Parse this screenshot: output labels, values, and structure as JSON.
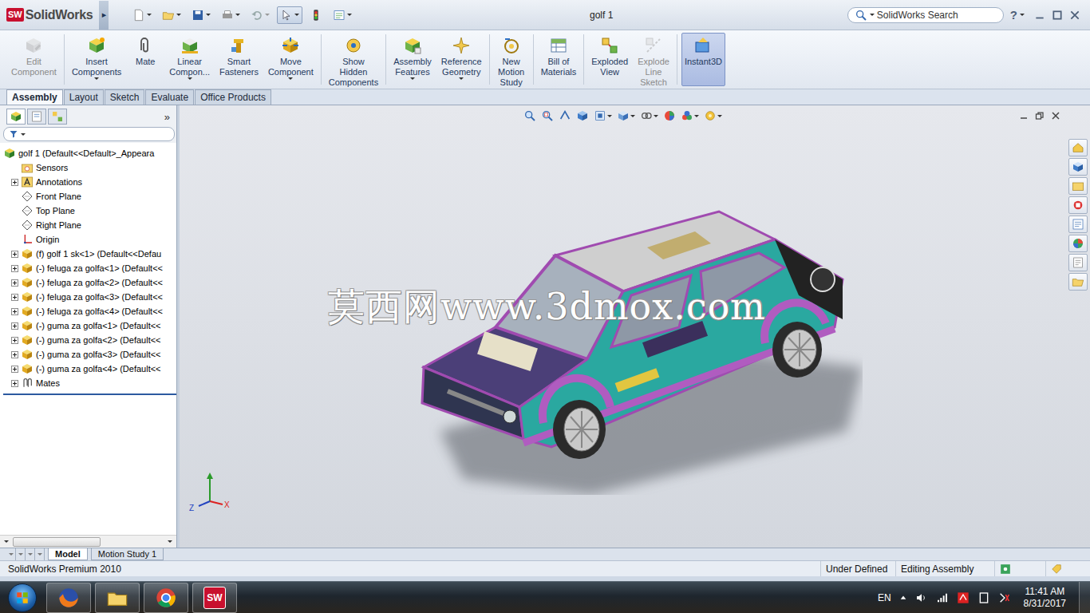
{
  "title_bar": {
    "logo_mark": "SW",
    "logo_text": "SolidWorks",
    "logo_flyout": "▸",
    "title": "golf 1",
    "search_placeholder": "SolidWorks Search",
    "help": "?"
  },
  "ribbon": [
    {
      "lines": [
        "Edit",
        "Component"
      ],
      "disabled": true,
      "dropdown": false,
      "selected": false
    },
    {
      "lines": [
        "Insert",
        "Components"
      ],
      "disabled": false,
      "dropdown": true,
      "selected": false
    },
    {
      "lines": [
        "Mate"
      ],
      "disabled": false,
      "dropdown": false,
      "selected": false
    },
    {
      "lines": [
        "Linear",
        "Compon..."
      ],
      "disabled": false,
      "dropdown": true,
      "selected": false
    },
    {
      "lines": [
        "Smart",
        "Fasteners"
      ],
      "disabled": false,
      "dropdown": false,
      "selected": false
    },
    {
      "lines": [
        "Move",
        "Component"
      ],
      "disabled": false,
      "dropdown": true,
      "selected": false
    },
    {
      "lines": [
        "Show",
        "Hidden",
        "Components"
      ],
      "disabled": false,
      "dropdown": false,
      "selected": false
    },
    {
      "lines": [
        "Assembly",
        "Features"
      ],
      "disabled": false,
      "dropdown": true,
      "selected": false
    },
    {
      "lines": [
        "Reference",
        "Geometry"
      ],
      "disabled": false,
      "dropdown": true,
      "selected": false
    },
    {
      "lines": [
        "New",
        "Motion",
        "Study"
      ],
      "disabled": false,
      "dropdown": false,
      "selected": false
    },
    {
      "lines": [
        "Bill of",
        "Materials"
      ],
      "disabled": false,
      "dropdown": false,
      "selected": false
    },
    {
      "lines": [
        "Exploded",
        "View"
      ],
      "disabled": false,
      "dropdown": false,
      "selected": false
    },
    {
      "lines": [
        "Explode",
        "Line",
        "Sketch"
      ],
      "disabled": true,
      "dropdown": false,
      "selected": false
    },
    {
      "lines": [
        "Instant3D"
      ],
      "disabled": false,
      "dropdown": false,
      "selected": true
    }
  ],
  "tabs": [
    {
      "label": "Assembly",
      "selected": true
    },
    {
      "label": "Layout",
      "selected": false
    },
    {
      "label": "Sketch",
      "selected": false
    },
    {
      "label": "Evaluate",
      "selected": false
    },
    {
      "label": "Office Products",
      "selected": false
    }
  ],
  "feature_manager": {
    "chevron": "»",
    "tree": [
      {
        "label": "golf 1 (Default<<Default>_Appeara",
        "kind": "assembly",
        "depth": 0,
        "expander": false
      },
      {
        "label": "Sensors",
        "kind": "sensors",
        "depth": 1,
        "expander": false
      },
      {
        "label": "Annotations",
        "kind": "annotations",
        "depth": 1,
        "expander": true
      },
      {
        "label": "Front Plane",
        "kind": "plane",
        "depth": 1,
        "expander": false
      },
      {
        "label": "Top Plane",
        "kind": "plane",
        "depth": 1,
        "expander": false
      },
      {
        "label": "Right Plane",
        "kind": "plane",
        "depth": 1,
        "expander": false
      },
      {
        "label": "Origin",
        "kind": "origin",
        "depth": 1,
        "expander": false
      },
      {
        "label": "(f) golf 1 sk<1> (Default<<Defau",
        "kind": "part",
        "depth": 1,
        "expander": true
      },
      {
        "label": "(-) feluga za golfa<1> (Default<<",
        "kind": "part",
        "depth": 1,
        "expander": true
      },
      {
        "label": "(-) feluga za golfa<2> (Default<<",
        "kind": "part",
        "depth": 1,
        "expander": true
      },
      {
        "label": "(-) feluga za golfa<3> (Default<<",
        "kind": "part",
        "depth": 1,
        "expander": true
      },
      {
        "label": "(-) feluga za golfa<4> (Default<<",
        "kind": "part",
        "depth": 1,
        "expander": true
      },
      {
        "label": "(-) guma za golfa<1> (Default<<",
        "kind": "part",
        "depth": 1,
        "expander": true
      },
      {
        "label": "(-) guma za golfa<2> (Default<<",
        "kind": "part",
        "depth": 1,
        "expander": true
      },
      {
        "label": "(-) guma za golfa<3> (Default<<",
        "kind": "part",
        "depth": 1,
        "expander": true
      },
      {
        "label": "(-) guma za golfa<4> (Default<<",
        "kind": "part",
        "depth": 1,
        "expander": true
      },
      {
        "label": "Mates",
        "kind": "mates",
        "depth": 1,
        "expander": true
      }
    ]
  },
  "graphics": {
    "watermark": "莫西网www.3dmox.com",
    "triad": {
      "z": "Z",
      "x": "X"
    }
  },
  "bottom_tabs": [
    {
      "label": "Model",
      "selected": true
    },
    {
      "label": "Motion Study 1",
      "selected": false
    }
  ],
  "status_bar": {
    "product": "SolidWorks Premium 2010",
    "state": "Under Defined",
    "mode": "Editing Assembly"
  },
  "taskbar": {
    "language": "EN",
    "time": "11:41 AM",
    "date": "8/31/2017"
  }
}
